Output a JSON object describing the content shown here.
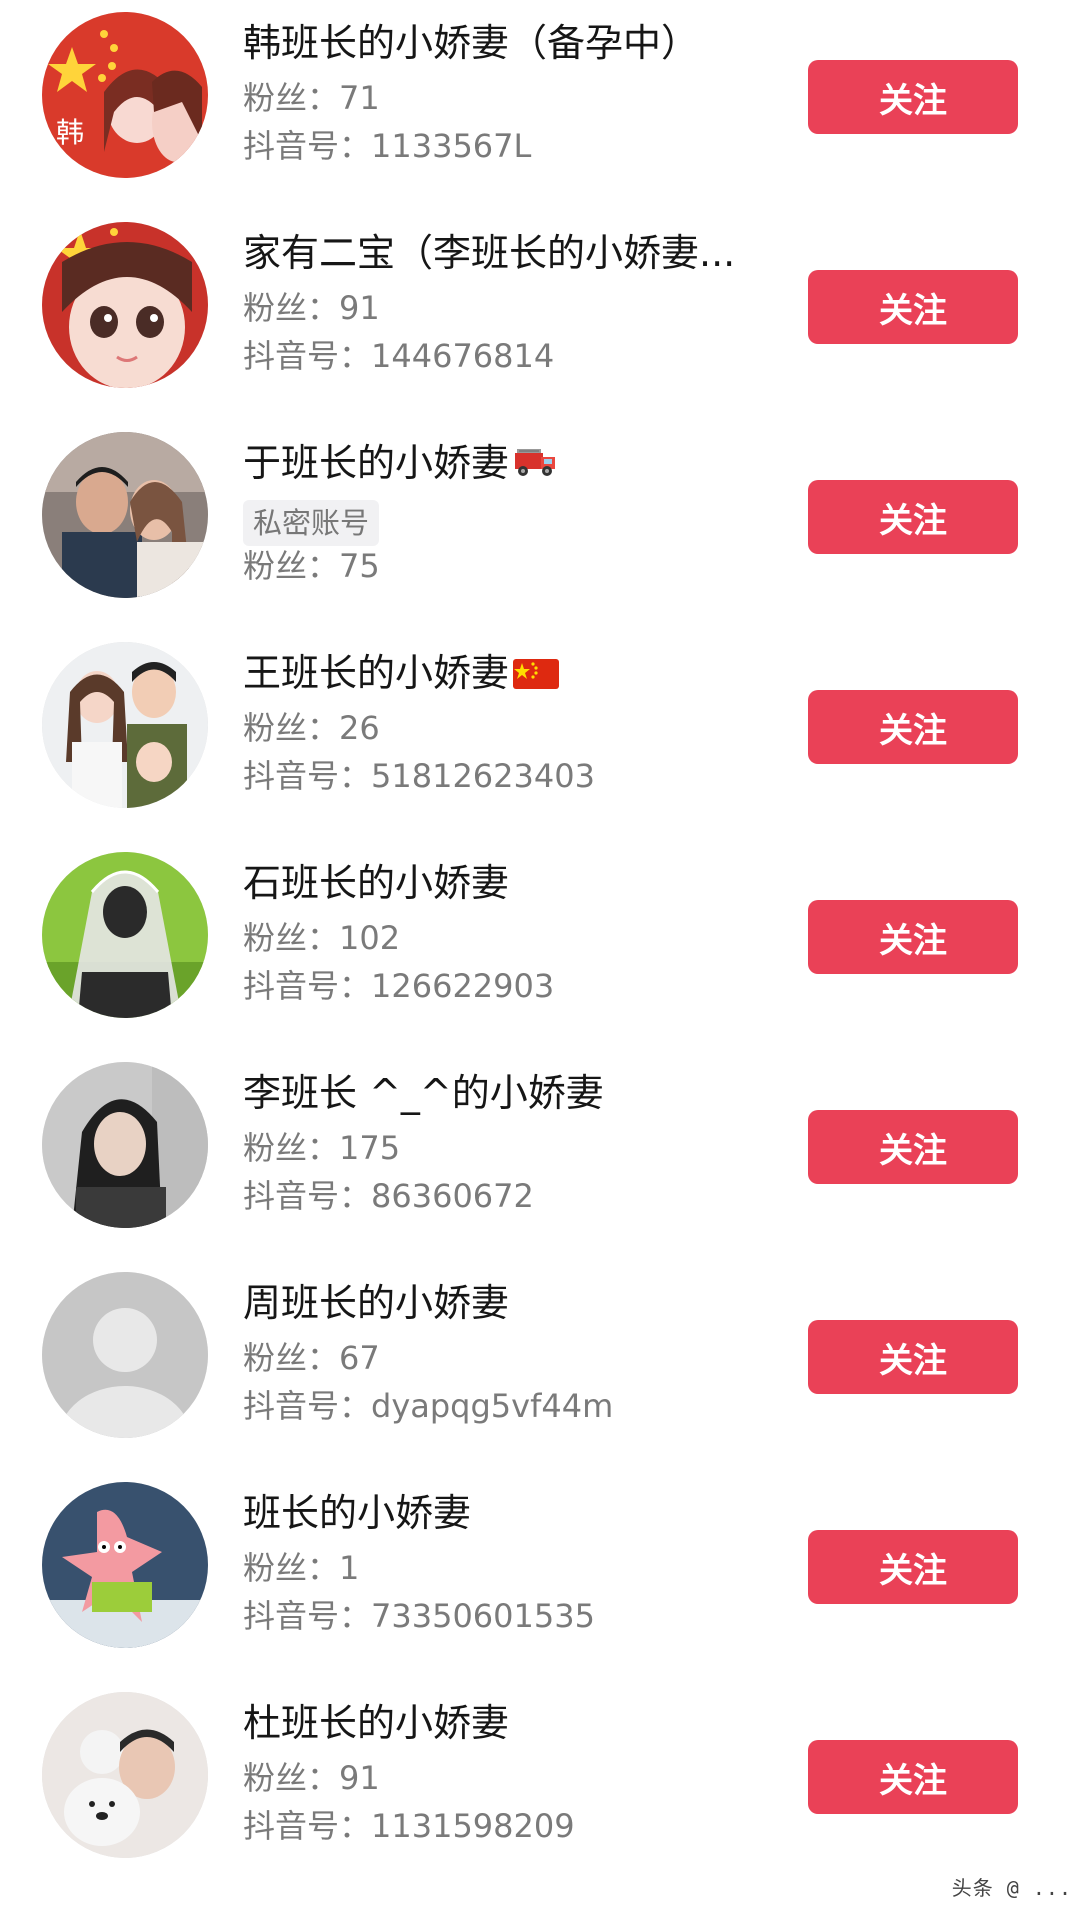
{
  "follow_label": "关注",
  "users": [
    {
      "name": "韩班长的小娇妻（备孕中）",
      "line2": "粉丝：71",
      "line3": "抖音号：1133567L",
      "avatar": "avatar-flag-couple-icon"
    },
    {
      "name": "家有二宝（李班长的小娇妻...",
      "line2": "粉丝：91",
      "line3": "抖音号：144676814",
      "avatar": "avatar-flag-girl-icon"
    },
    {
      "name": "于班长的小娇妻",
      "tag": "私密账号",
      "line3": "粉丝：75",
      "avatar": "avatar-wedding-couple-icon",
      "emoji": "fire-truck-icon"
    },
    {
      "name": "王班长的小娇妻",
      "line2": "粉丝：26",
      "line3": "抖音号：51812623403",
      "avatar": "avatar-family-illustration-icon",
      "emoji": "china-flag-icon"
    },
    {
      "name": "石班长的小娇妻",
      "line2": "粉丝：102",
      "line3": "抖音号：126622903",
      "avatar": "avatar-veil-icon"
    },
    {
      "name": "李班长 ^_^的小娇妻",
      "line2": "粉丝：175",
      "line3": "抖音号：86360672",
      "avatar": "avatar-selfie-icon"
    },
    {
      "name": "周班长的小娇妻",
      "line2": "粉丝：67",
      "line3": "抖音号：dyapqg5vf44m",
      "avatar": "default-avatar-icon"
    },
    {
      "name": "班长的小娇妻",
      "line2": "粉丝：1",
      "line3": "抖音号：73350601535",
      "avatar": "avatar-cartoon-starfish-icon"
    },
    {
      "name": "杜班长的小娇妻",
      "line2": "粉丝：91",
      "line3": "抖音号：1131598209",
      "avatar": "avatar-baby-bear-icon"
    }
  ],
  "colors": {
    "accent": "#ea4157",
    "name_text": "#161616",
    "meta_text": "#7a7a7a"
  },
  "watermark": "头条 @ ..."
}
